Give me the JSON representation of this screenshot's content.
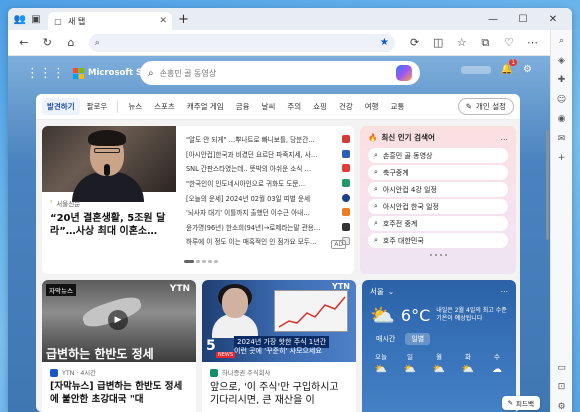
{
  "browser": {
    "tab_title": "새 탭",
    "address_placeholder": "",
    "new_tab": "+"
  },
  "header": {
    "brand": "Microsoft Start",
    "search_placeholder": "손흥민 골 동영상",
    "notification_count": "1"
  },
  "nav": {
    "items": [
      "발견하기",
      "팔로우",
      "뉴스",
      "스포츠",
      "캐주얼 게임",
      "금융",
      "날씨",
      "주의",
      "쇼핑",
      "건강",
      "여행",
      "교통"
    ],
    "personalize": "개인 설정"
  },
  "top_story": {
    "source": "서울신문",
    "headline": "“20년 결혼생활, 5조원 달라”…사상 최대 이혼소…",
    "list": [
      "\"알도 안 되게\" …뿌나트로 빠니보틀, 당분간…",
      "[아시안컵]한국과 비겼던 요르단 파죽지세, 사…",
      "SNL 간판스타였는데.. 뜻박의 아쉬운 소식 …",
      "\"한국인이 인도네시아인으로 귀화도 도문…",
      "[오늘의 운세] 2024년 02월 03일 띠별 운세",
      "'뇌사자 대기' 이틀까지 출했던 이수근 아내…",
      "윤가명(96년) 한소희(94년)→로제라는말 관용…",
      "하루에 이 정도 이는 매혹적인 인 점가요 모두…"
    ],
    "ad_label": "AD"
  },
  "trending": {
    "title": "최신 인기 검색어",
    "more": "…",
    "items": [
      "손흥민 골 동영상",
      "축구중계",
      "아시안컵 4강 일정",
      "아시안컵 한국 일정",
      "호주전 중계",
      "호주 대한민국"
    ]
  },
  "card_video": {
    "tag": "자막뉴스",
    "channel": "YTN",
    "caption": "급변하는 한반도 정세",
    "source": "YTN · 4시간",
    "headline": "[자막뉴스] 급변하는 한반도 정세에 불안한 초강대국 \"대"
  },
  "card_finance": {
    "channel": "YTN",
    "num": "5",
    "news": "NEWS",
    "cap1": "2024년 가장 핫한 주식 1년간",
    "cap2": "이런 곳에 '꾸준히' 사모으세요",
    "source": "하나증권 주식회사",
    "headline": "앞으로, '이 주식'만 구입하시고 기다리시면, 큰 재산을 이"
  },
  "weather": {
    "location": "서울",
    "temp": "6°C",
    "desc": "내일은 2월 4일의 최고 수준 기온이 예상됩니다",
    "tabs": [
      "매시간",
      "일별"
    ],
    "days": [
      "오늘",
      "일",
      "월",
      "화",
      "수"
    ]
  },
  "feedback": "피드백",
  "colors": {
    "accent": "#1b4ea3",
    "weather_bg": "#2b62a8",
    "trend_bg": "#fbe0e0"
  }
}
